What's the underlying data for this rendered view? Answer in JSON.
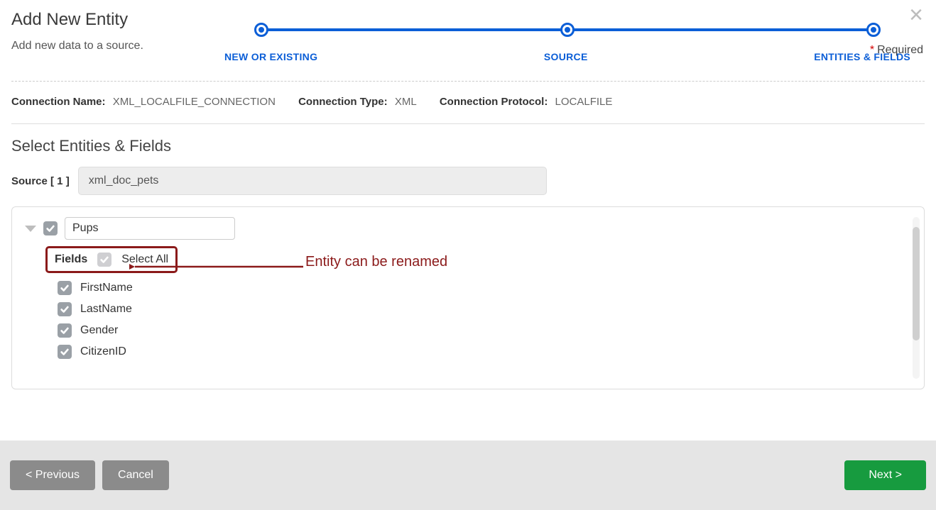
{
  "header": {
    "title": "Add New Entity",
    "subtitle": "Add new data to a source.",
    "required_label": "Required"
  },
  "stepper": {
    "steps": [
      "NEW OR EXISTING",
      "SOURCE",
      "ENTITIES & FIELDS"
    ]
  },
  "connection": {
    "name_label": "Connection Name:",
    "name_value": "XML_LOCALFILE_CONNECTION",
    "type_label": "Connection Type:",
    "type_value": "XML",
    "protocol_label": "Connection Protocol:",
    "protocol_value": "LOCALFILE"
  },
  "section": {
    "title": "Select Entities & Fields",
    "source_label": "Source [ 1 ]",
    "source_value": "xml_doc_pets"
  },
  "entity": {
    "name": "Pups",
    "fields_label": "Fields",
    "select_all_label": "Select All",
    "fields": [
      "FirstName",
      "LastName",
      "Gender",
      "CitizenID"
    ]
  },
  "annotation": {
    "text": "Entity can be renamed"
  },
  "footer": {
    "previous": "< Previous",
    "cancel": "Cancel",
    "next": "Next >"
  }
}
